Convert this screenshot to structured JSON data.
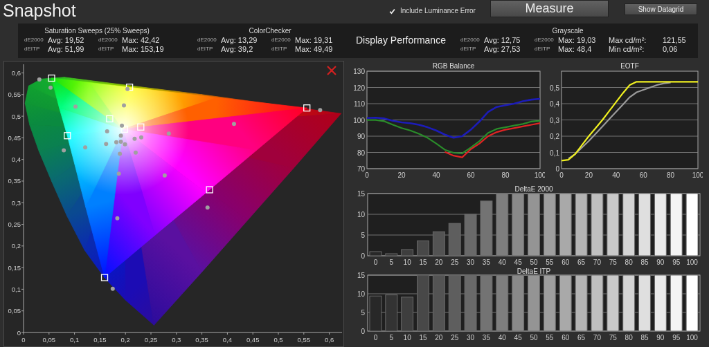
{
  "header": {
    "title": "Snapshot",
    "include_luminance_error": {
      "label": "Include Luminance Error",
      "checked": true
    },
    "buttons": [
      {
        "label": "Measure",
        "kind": "primary"
      },
      {
        "label": "Show Datagrid",
        "kind": "secondary"
      }
    ]
  },
  "summary": {
    "blocks": [
      {
        "kind": "metrics",
        "title": "Saturation Sweeps (25% Sweeps)",
        "rows": [
          {
            "cells": [
              {
                "tag": "dE2000",
                "value": "Avg: 19,52"
              },
              {
                "tag": "dE2000",
                "value": "Max: 42,42"
              }
            ]
          },
          {
            "cells": [
              {
                "tag": "dEITP",
                "value": "Avg: 51,99"
              },
              {
                "tag": "dEITP",
                "value": "Max: 153,19"
              }
            ]
          }
        ]
      },
      {
        "kind": "metrics",
        "title": "ColorChecker",
        "rows": [
          {
            "cells": [
              {
                "tag": "dE2000",
                "value": "Avg: 13,29"
              },
              {
                "tag": "dE2000",
                "value": "Max: 19,31"
              }
            ]
          },
          {
            "cells": [
              {
                "tag": "dEITP",
                "value": "Avg: 39,2"
              },
              {
                "tag": "dEITP",
                "value": "Max: 49,49"
              }
            ]
          }
        ]
      },
      {
        "kind": "heading",
        "title": "Display Performance"
      },
      {
        "kind": "metrics",
        "title": "Grayscale",
        "rows": [
          {
            "cells": [
              {
                "tag": "dE2000",
                "value": "Avg: 12,75"
              },
              {
                "tag": "dE2000",
                "value": "Max: 19,03"
              },
              {
                "label": "Max cd/m²:",
                "value": "121,55"
              }
            ]
          },
          {
            "cells": [
              {
                "tag": "dEITP",
                "value": "Avg: 27,53"
              },
              {
                "tag": "dEITP",
                "value": "Max: 48,4"
              },
              {
                "label": "Min cd/m²:",
                "value": "0,06"
              }
            ]
          }
        ]
      }
    ]
  },
  "chromaticity": {
    "chart_data": {
      "type": "scatter",
      "xlim": [
        0,
        0.625
      ],
      "ylim": [
        0,
        0.62
      ],
      "xticks": [
        0,
        {
          "value": 0.05,
          "label": "0,05"
        },
        {
          "value": 0.1,
          "label": "0,1"
        },
        {
          "value": 0.15,
          "label": "0,15"
        },
        {
          "value": 0.2,
          "label": "0,2"
        },
        {
          "value": 0.25,
          "label": "0,25"
        },
        {
          "value": 0.3,
          "label": "0,3"
        },
        {
          "value": 0.35,
          "label": "0,35"
        },
        {
          "value": 0.4,
          "label": "0,4"
        },
        {
          "value": 0.45,
          "label": "0,45"
        },
        {
          "value": 0.5,
          "label": "0,5"
        },
        {
          "value": 0.55,
          "label": "0,55"
        },
        {
          "value": 0.6,
          "label": "0,6"
        }
      ],
      "yticks": [
        0,
        {
          "value": 0.05,
          "label": "0,05"
        },
        {
          "value": 0.1,
          "label": "0,1"
        },
        {
          "value": 0.15,
          "label": "0,15"
        },
        {
          "value": 0.2,
          "label": "0,2"
        },
        {
          "value": 0.25,
          "label": "0,25"
        },
        {
          "value": 0.3,
          "label": "0,3"
        },
        {
          "value": 0.35,
          "label": "0,35"
        },
        {
          "value": 0.4,
          "label": "0,4"
        },
        {
          "value": 0.45,
          "label": "0,45"
        },
        {
          "value": 0.5,
          "label": "0,5"
        },
        {
          "value": 0.55,
          "label": "0,55"
        },
        {
          "value": 0.6,
          "label": "0,6"
        }
      ],
      "series": [
        {
          "color": "#ffffff",
          "x": [
            0.055,
            0.208,
            0.556,
            0.169,
            0.086,
            0.198,
            0.23,
            0.365,
            0.159
          ],
          "values": [
            0.588,
            0.567,
            0.519,
            0.494,
            0.455,
            0.47,
            0.475,
            0.33,
            0.127
          ]
        },
        {
          "color": "#a0a0a0",
          "x": [
            0.031,
            0.053,
            0.102,
            0.204,
            0.197,
            0.582,
            0.413,
            0.193,
            0.285,
            0.164,
            0.231,
            0.191,
            0.218,
            0.182,
            0.191,
            0.199,
            0.162,
            0.121,
            0.079,
            0.189,
            0.22,
            0.187,
            0.277,
            0.361,
            0.184,
            0.175
          ],
          "values": [
            0.585,
            0.566,
            0.522,
            0.563,
            0.525,
            0.514,
            0.482,
            0.478,
            0.46,
            0.465,
            0.451,
            0.455,
            0.448,
            0.44,
            0.441,
            0.435,
            0.436,
            0.428,
            0.421,
            0.413,
            0.416,
            0.367,
            0.363,
            0.289,
            0.264,
            0.101
          ]
        }
      ]
    }
  },
  "line_charts": [
    {
      "chart_data": {
        "type": "line",
        "title": "RGB Balance",
        "grid": true,
        "x": [
          0,
          5,
          10,
          15,
          20,
          25,
          30,
          35,
          40,
          45,
          50,
          55,
          60,
          65,
          70,
          75,
          80,
          85,
          90,
          95,
          100
        ],
        "xlim": [
          0,
          100
        ],
        "ylim": [
          70,
          130
        ],
        "xticks": [
          0,
          20,
          40,
          60,
          80,
          100
        ],
        "yticks": [
          70,
          80,
          90,
          100,
          110,
          120,
          130
        ],
        "series": [
          {
            "color": "#2a8c2a",
            "values": [
              99.9,
              99.9,
              99.2,
              97,
              95,
              93.5,
              91.5,
              89,
              85.5,
              81.6,
              79.8,
              79.4,
              83,
              87,
              92,
              94.5,
              95.5,
              96.5,
              97.5,
              99,
              99.5
            ]
          },
          {
            "color": "#e02424",
            "values": [
              null,
              null,
              null,
              null,
              null,
              null,
              null,
              null,
              null,
              80.3,
              78,
              77,
              82,
              85.5,
              90,
              92.5,
              94,
              95,
              96,
              97,
              98
            ]
          },
          {
            "color": "#1c1cb8",
            "values": [
              101.2,
              101.4,
              100.9,
              99.5,
              98.5,
              98,
              97,
              95.5,
              93.5,
              91,
              89,
              90,
              94,
              99,
              105,
              108,
              109,
              110,
              111.5,
              112.5,
              113
            ]
          }
        ]
      }
    },
    {
      "chart_data": {
        "type": "line",
        "title": "EOTF",
        "grid": true,
        "x": [
          0,
          5,
          10,
          15,
          20,
          25,
          30,
          35,
          40,
          45,
          50,
          55,
          60,
          65,
          70,
          75,
          80,
          85,
          90,
          95,
          100
        ],
        "xlim": [
          0,
          100
        ],
        "ylim": [
          0,
          0.6
        ],
        "xticks": [
          0,
          20,
          40,
          60,
          80,
          100
        ],
        "yticks": [
          0,
          {
            "value": 0.1,
            "label": "0,1"
          },
          {
            "value": 0.2,
            "label": "0,2"
          },
          {
            "value": 0.3,
            "label": "0,3"
          },
          {
            "value": 0.4,
            "label": "0,4"
          },
          {
            "value": 0.5,
            "label": "0,5"
          }
        ],
        "series": [
          {
            "color": "#9a9a9a",
            "values": [
              null,
              0.062,
              0.09,
              0.13,
              0.17,
              0.215,
              0.26,
              0.305,
              0.35,
              0.395,
              0.44,
              0.47,
              0.485,
              0.5,
              0.515,
              0.525,
              0.53,
              null,
              null,
              null,
              null
            ]
          },
          {
            "color": "#f0f020",
            "values": [
              0.05,
              0.055,
              0.09,
              0.145,
              0.2,
              0.25,
              0.3,
              0.355,
              0.41,
              0.465,
              0.515,
              0.535,
              0.535,
              0.535,
              0.535,
              0.535,
              0.535,
              0.535,
              0.535,
              0.535,
              0.535
            ]
          }
        ]
      }
    }
  ],
  "bar_charts": [
    {
      "chart_data": {
        "type": "bar",
        "title": "DeltaE 2000",
        "grid": true,
        "categories": [
          "0",
          "5",
          "10",
          "15",
          "20",
          "25",
          "30",
          "35",
          "40",
          "45",
          "50",
          "55",
          "60",
          "65",
          "70",
          "75",
          "80",
          "85",
          "90",
          "95",
          "100"
        ],
        "ylim": [
          0,
          15
        ],
        "yticks": [
          0,
          5,
          10,
          15
        ],
        "values": [
          1,
          0.5,
          1.5,
          3.6,
          5.8,
          7.8,
          10,
          13.2,
          15,
          15,
          15,
          15,
          15,
          15,
          15,
          15,
          15,
          15,
          15,
          15,
          15
        ]
      }
    },
    {
      "chart_data": {
        "type": "bar",
        "title": "DeltaE ITP",
        "grid": true,
        "categories": [
          "0",
          "5",
          "10",
          "15",
          "20",
          "25",
          "30",
          "35",
          "40",
          "45",
          "50",
          "55",
          "60",
          "65",
          "70",
          "75",
          "80",
          "85",
          "90",
          "95",
          "100"
        ],
        "ylim": [
          0,
          15
        ],
        "yticks": [
          0,
          5,
          10,
          15
        ],
        "values": [
          9.4,
          9.7,
          9.1,
          15,
          15,
          15,
          15,
          15,
          15,
          15,
          15,
          15,
          15,
          15,
          15,
          15,
          15,
          15,
          15,
          15,
          15
        ]
      }
    }
  ]
}
